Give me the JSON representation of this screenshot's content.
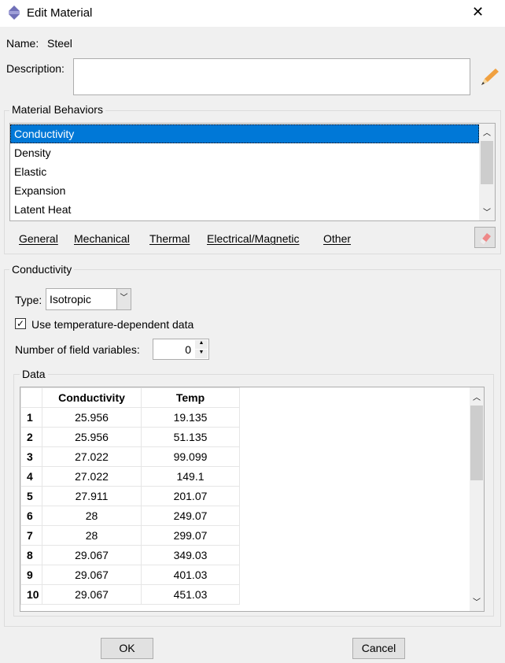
{
  "window": {
    "title": "Edit Material",
    "close": "✕"
  },
  "name": {
    "label": "Name:",
    "value": "Steel"
  },
  "description": {
    "label": "Description:",
    "value": ""
  },
  "behaviors": {
    "title": "Material Behaviors",
    "items": [
      "Conductivity",
      "Density",
      "Elastic",
      "Expansion",
      "Latent Heat"
    ],
    "selected": "Conductivity",
    "menus": [
      "General",
      "Mechanical",
      "Thermal",
      "Electrical/Magnetic",
      "Other"
    ]
  },
  "section": {
    "title": "Conductivity",
    "type_label": "Type:",
    "type_value": "Isotropic",
    "checkbox_label": "Use temperature-dependent data",
    "checkbox_checked": true,
    "fieldvars_label": "Number of field variables:",
    "fieldvars_value": "0"
  },
  "data": {
    "title": "Data",
    "columns": [
      "Conductivity",
      "Temp"
    ],
    "rows": [
      [
        "1",
        "25.956",
        "19.135"
      ],
      [
        "2",
        "25.956",
        "51.135"
      ],
      [
        "3",
        "27.022",
        "99.099"
      ],
      [
        "4",
        "27.022",
        "149.1"
      ],
      [
        "5",
        "27.911",
        "201.07"
      ],
      [
        "6",
        "28",
        "249.07"
      ],
      [
        "7",
        "28",
        "299.07"
      ],
      [
        "8",
        "29.067",
        "349.03"
      ],
      [
        "9",
        "29.067",
        "401.03"
      ],
      [
        "10",
        "29.067",
        "451.03"
      ]
    ]
  },
  "buttons": {
    "ok": "OK",
    "cancel": "Cancel"
  },
  "colors": {
    "selection": "#0078d7"
  }
}
